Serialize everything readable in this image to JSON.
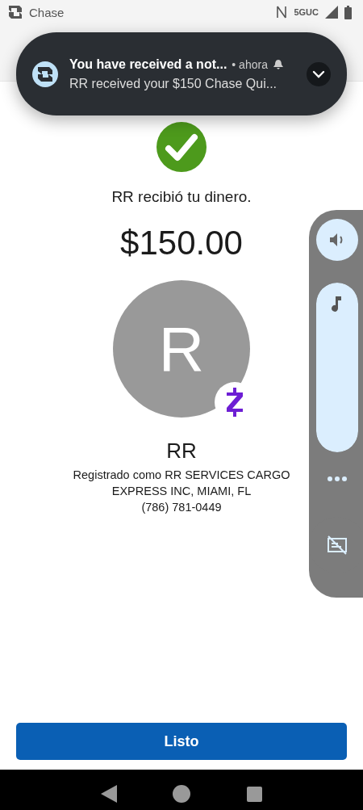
{
  "status_bar": {
    "app_name": "Chase",
    "network": "5GUC"
  },
  "notification": {
    "title": "You have received a not...",
    "time": "• ahora",
    "body": "RR received your $150 Chase Qui..."
  },
  "confirmation": {
    "message": "RR recibió tu dinero.",
    "amount": "$150.00"
  },
  "recipient": {
    "initial": "R",
    "name": "RR",
    "registered_as": "Registrado como RR SERVICES CARGO EXPRESS INC, MIAMI, FL",
    "phone": "(786) 781-0449"
  },
  "volume_panel": {
    "level": 1.0
  },
  "done_button": {
    "label": "Listo"
  }
}
